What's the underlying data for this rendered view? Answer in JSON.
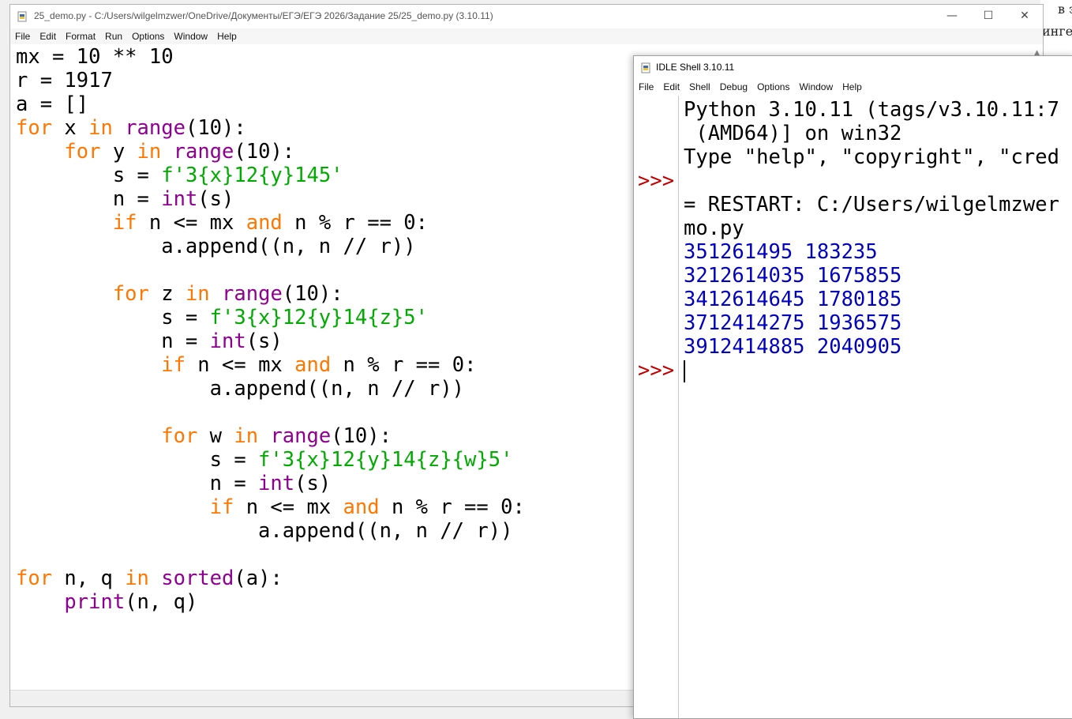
{
  "background": {
    "line1": "в эт",
    "line2": "инге"
  },
  "editor": {
    "title": "25_demo.py - C:/Users/wilgelmzwer/OneDrive/Документы/ЕГЭ/ЕГЭ 2026/Задание 25/25_demo.py (3.10.11)",
    "menu": [
      "File",
      "Edit",
      "Format",
      "Run",
      "Options",
      "Window",
      "Help"
    ],
    "code_lines": [
      "mx = 10 ** 10",
      "r = 1917",
      "a = []",
      "for x in range(10):",
      "    for y in range(10):",
      "        s = f'3{x}12{y}145'",
      "        n = int(s)",
      "        if n <= mx and n % r == 0:",
      "            a.append((n, n // r))",
      "",
      "        for z in range(10):",
      "            s = f'3{x}12{y}14{z}5'",
      "            n = int(s)",
      "            if n <= mx and n % r == 0:",
      "                a.append((n, n // r))",
      "",
      "            for w in range(10):",
      "                s = f'3{x}12{y}14{z}{w}5'",
      "                n = int(s)",
      "                if n <= mx and n % r == 0:",
      "                    a.append((n, n // r))",
      "",
      "for n, q in sorted(a):",
      "    print(n, q)"
    ]
  },
  "shell": {
    "title": "IDLE Shell 3.10.11",
    "menu": [
      "File",
      "Edit",
      "Shell",
      "Debug",
      "Options",
      "Window",
      "Help"
    ],
    "gutter": [
      "",
      "",
      "",
      ">>>",
      "",
      "",
      "",
      "",
      "",
      "",
      "",
      ">>>"
    ],
    "header_lines": [
      "Python 3.10.11 (tags/v3.10.11:7",
      " (AMD64)] on win32",
      "Type \"help\", \"copyright\", \"cred",
      "",
      "= RESTART: C:/Users/wilgelmzwer",
      "mo.py"
    ],
    "output_lines": [
      "351261495 183235",
      "3212614035 1675855",
      "3412614645 1780185",
      "3712414275 1936575",
      "3912414885 2040905"
    ]
  },
  "window_controls": {
    "minimize": "—",
    "maximize": "☐",
    "close": "✕"
  },
  "colors": {
    "keyword": "#ff7700",
    "builtin": "#900090",
    "string": "#00aa00",
    "output": "#0000c0",
    "prompt": "#c00000"
  }
}
